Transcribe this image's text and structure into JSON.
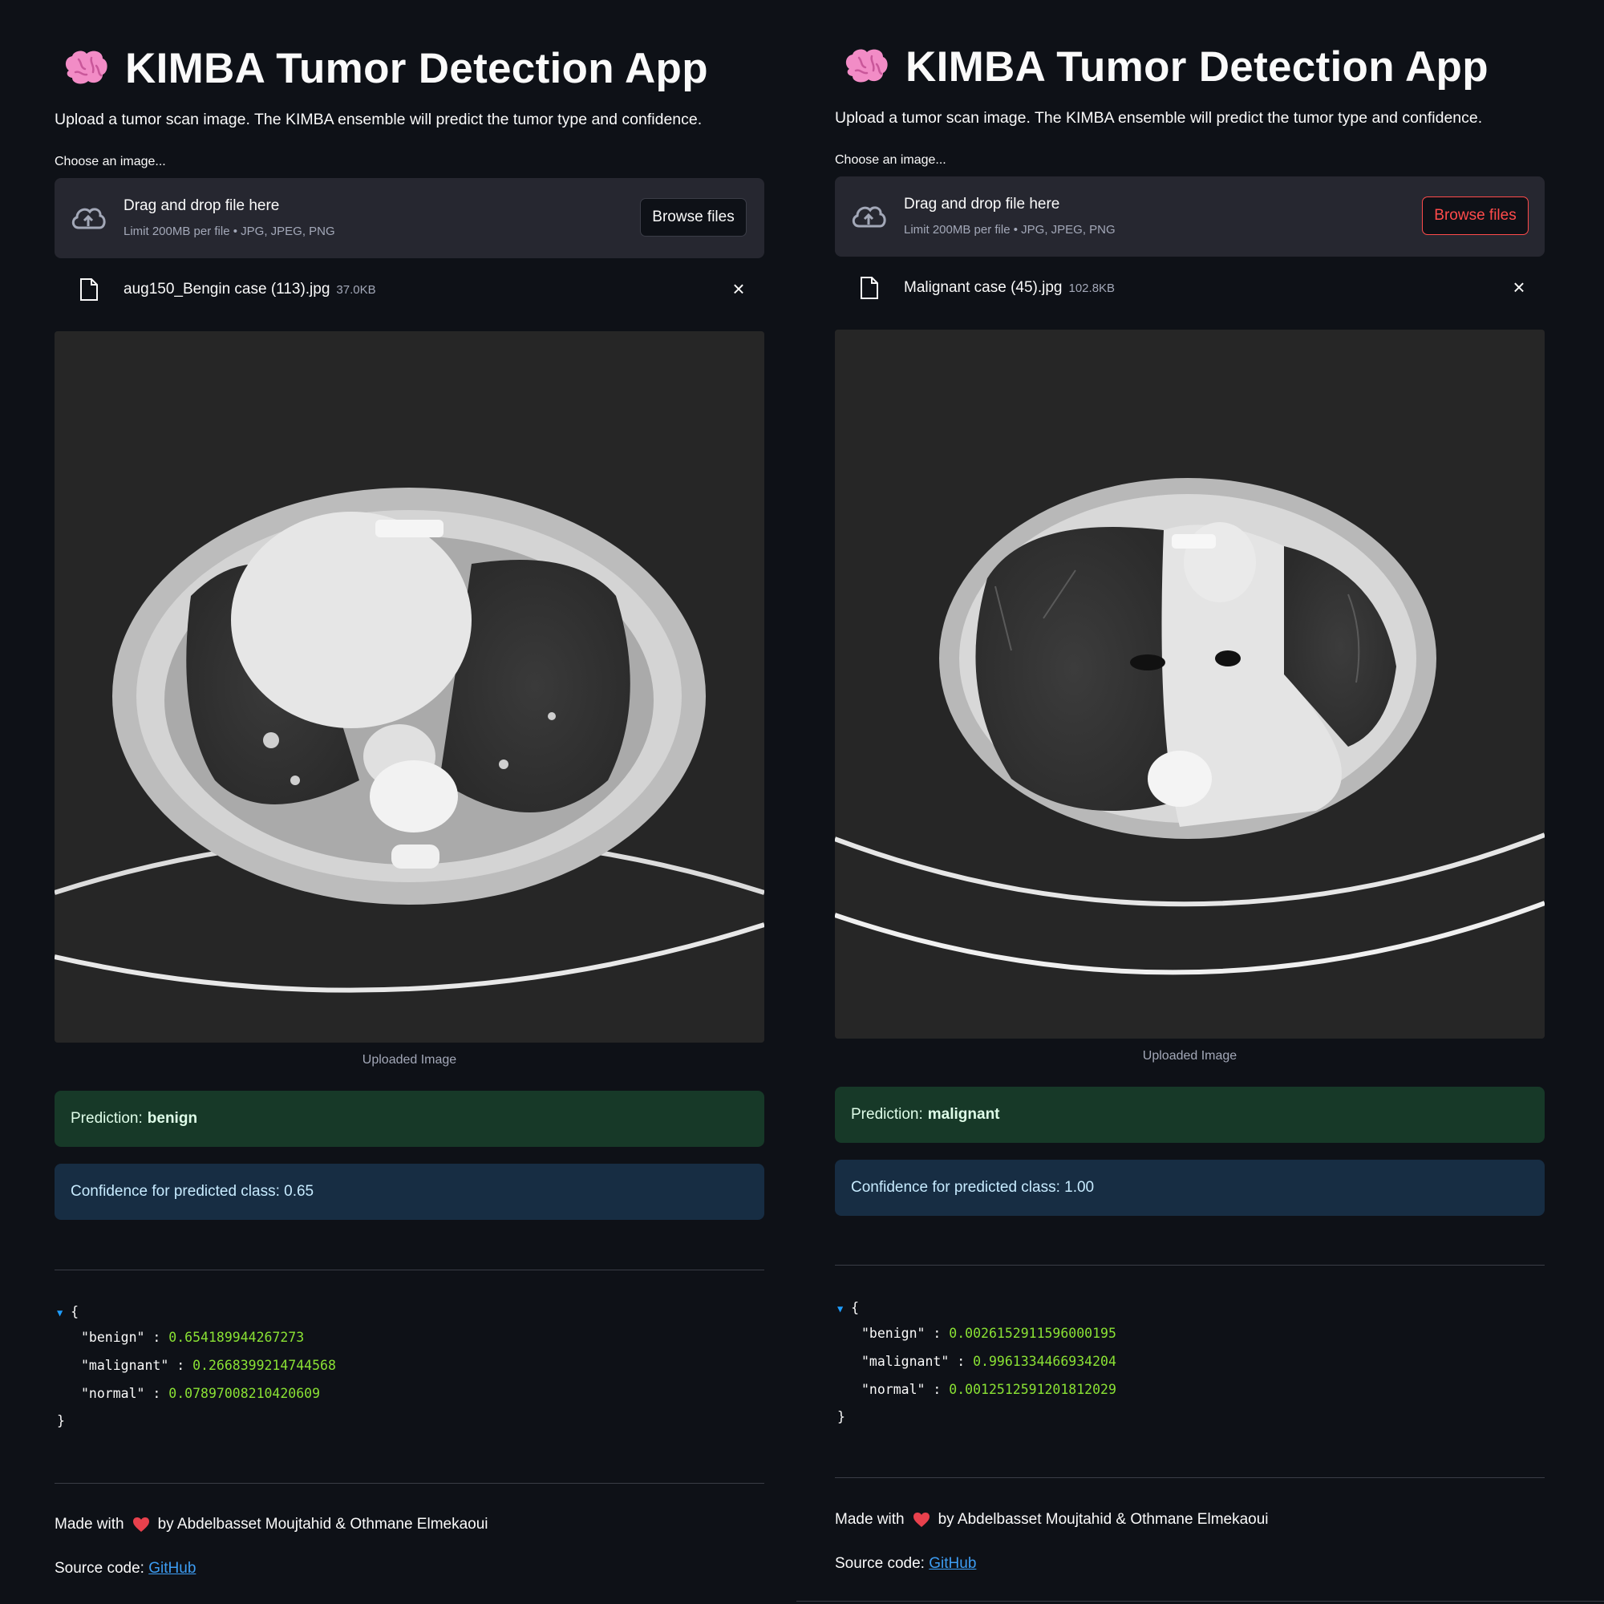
{
  "colors": {
    "background": "#0e1117",
    "dropzone": "#262730",
    "success_bg": "#173928",
    "info_bg": "#172d43",
    "accent_red": "#ff4b4b",
    "json_value": "#8ae234",
    "link": "#3d9df3"
  },
  "panels": [
    {
      "title": "KIMBA Tumor Detection App",
      "title_icon": "brain-icon",
      "subtitle": "Upload a tumor scan image. The KIMBA ensemble will predict the tumor type and confidence.",
      "uploader": {
        "label": "Choose an image...",
        "drag_text": "Drag and drop file here",
        "limit_text": "Limit 200MB per file • JPG, JPEG, PNG",
        "browse_label": "Browse files"
      },
      "file": {
        "name": "aug150_Bengin case (113).jpg",
        "size": "37.0KB"
      },
      "image_caption": "Uploaded Image",
      "prediction_label": "Prediction:",
      "prediction_value": "benign",
      "confidence_text": "Confidence for predicted class: 0.65",
      "json_open": "{",
      "json_close": "}",
      "scores": [
        {
          "key": "\"benign\"",
          "value": "0.654189944267273"
        },
        {
          "key": "\"malignant\"",
          "value": "0.2668399214744568"
        },
        {
          "key": "\"normal\"",
          "value": "0.07897008210420609"
        }
      ],
      "footer": {
        "made_with": "Made with",
        "by_text": "by Abdelbasset Moujtahid & Othmane Elmekaoui",
        "source_label": "Source code:",
        "source_link": "GitHub"
      }
    },
    {
      "title": "KIMBA Tumor Detection App",
      "title_icon": "brain-icon",
      "subtitle": "Upload a tumor scan image. The KIMBA ensemble will predict the tumor type and confidence.",
      "uploader": {
        "label": "Choose an image...",
        "drag_text": "Drag and drop file here",
        "limit_text": "Limit 200MB per file • JPG, JPEG, PNG",
        "browse_label": "Browse files"
      },
      "file": {
        "name": "Malignant case (45).jpg",
        "size": "102.8KB"
      },
      "image_caption": "Uploaded Image",
      "prediction_label": "Prediction:",
      "prediction_value": "malignant",
      "confidence_text": "Confidence for predicted class: 1.00",
      "json_open": "{",
      "json_close": "}",
      "scores": [
        {
          "key": "\"benign\"",
          "value": "0.0026152911596000195"
        },
        {
          "key": "\"malignant\"",
          "value": "0.9961334466934204"
        },
        {
          "key": "\"normal\"",
          "value": "0.0012512591201812029"
        }
      ],
      "footer": {
        "made_with": "Made with",
        "by_text": "by Abdelbasset Moujtahid & Othmane Elmekaoui",
        "source_label": "Source code:",
        "source_link": "GitHub"
      }
    }
  ]
}
